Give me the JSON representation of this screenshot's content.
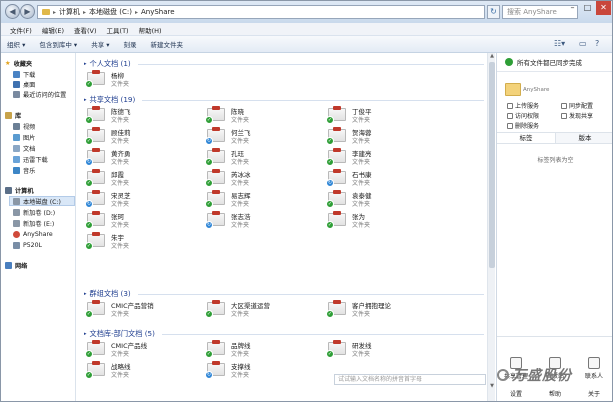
{
  "window": {
    "address": [
      "计算机",
      "本地磁盘 (C:)",
      "AnyShare"
    ],
    "search_placeholder": "搜索 AnyShare"
  },
  "menu": [
    "文件(F)",
    "编辑(E)",
    "查看(V)",
    "工具(T)",
    "帮助(H)"
  ],
  "toolbar": [
    "组织 ▾",
    "包含到库中 ▾",
    "共享 ▾",
    "刻录",
    "新建文件夹"
  ],
  "nav": {
    "favorites": "收藏夹",
    "fav_items": [
      "下载",
      "桌面",
      "最近访问的位置"
    ],
    "libraries": "库",
    "lib_items": [
      "视频",
      "图片",
      "文档",
      "迅雷下载",
      "音乐"
    ],
    "computer": "计算机",
    "comp_items": [
      "本地磁盘 (C:)",
      "新加卷 (D:)",
      "新加卷 (E:)",
      "AnyShare",
      "P520L"
    ],
    "network": "网络"
  },
  "groups": [
    {
      "title": "个人文档 (1)",
      "items": [
        {
          "name": "杨柳",
          "type": "文件夹",
          "sync": false
        }
      ]
    },
    {
      "title": "共享文档 (19)",
      "items": [
        {
          "name": "陈德飞",
          "type": "文件夹",
          "sync": false
        },
        {
          "name": "陈晓",
          "type": "文件夹",
          "sync": false
        },
        {
          "name": "丁俊平",
          "type": "文件夹",
          "sync": false
        },
        {
          "name": "顾佳莉",
          "type": "文件夹",
          "sync": false
        },
        {
          "name": "何兰飞",
          "type": "文件夹",
          "sync": true
        },
        {
          "name": "贺海蓉",
          "type": "文件夹",
          "sync": false
        },
        {
          "name": "黄齐勇",
          "type": "文件夹",
          "sync": true
        },
        {
          "name": "孔珏",
          "type": "文件夹",
          "sync": false
        },
        {
          "name": "李建亮",
          "type": "文件夹",
          "sync": false
        },
        {
          "name": "邱霞",
          "type": "文件夹",
          "sync": false
        },
        {
          "name": "芮冰冰",
          "type": "文件夹",
          "sync": false
        },
        {
          "name": "石书康",
          "type": "文件夹",
          "sync": true
        },
        {
          "name": "宋灵芝",
          "type": "文件夹",
          "sync": true
        },
        {
          "name": "易志辉",
          "type": "文件夹",
          "sync": false
        },
        {
          "name": "袁泰健",
          "type": "文件夹",
          "sync": false
        },
        {
          "name": "张珂",
          "type": "文件夹",
          "sync": false
        },
        {
          "name": "张志浩",
          "type": "文件夹",
          "sync": true
        },
        {
          "name": "张为",
          "type": "文件夹",
          "sync": false
        },
        {
          "name": "朱宇",
          "type": "文件夹",
          "sync": false
        }
      ]
    },
    {
      "title": "群组文档 (3)",
      "items": [
        {
          "name": "CMIC产品营销",
          "type": "文件夹",
          "sync": false
        },
        {
          "name": "大区渠道运营",
          "type": "文件夹",
          "sync": false
        },
        {
          "name": "客户拥抱理论",
          "type": "文件夹",
          "sync": false
        }
      ]
    },
    {
      "title": "文档库-部门文档 (5)",
      "items": [
        {
          "name": "CMIC产品线",
          "type": "文件夹",
          "sync": false
        },
        {
          "name": "品牌线",
          "type": "文件夹",
          "sync": false
        },
        {
          "name": "研发线",
          "type": "文件夹",
          "sync": false
        },
        {
          "name": "战略线",
          "type": "文件夹",
          "sync": false
        },
        {
          "name": "支撑线",
          "type": "文件夹",
          "sync": true
        }
      ]
    }
  ],
  "panel": {
    "status": "所有文件都已同步完成",
    "folder_label": "AnyShare",
    "actions": [
      "上传服务",
      "访问权限",
      "删除服务",
      "同步配置",
      "发现共享"
    ],
    "tabs": [
      "标签",
      "版本"
    ],
    "empty": "标签列表为空",
    "bottom": [
      "共享管理",
      "回收站",
      "联系人",
      "设置",
      "帮助",
      "关于"
    ]
  },
  "filter_placeholder": "试试输入文档名称的拼音首字母",
  "watermark": "万盛股份"
}
